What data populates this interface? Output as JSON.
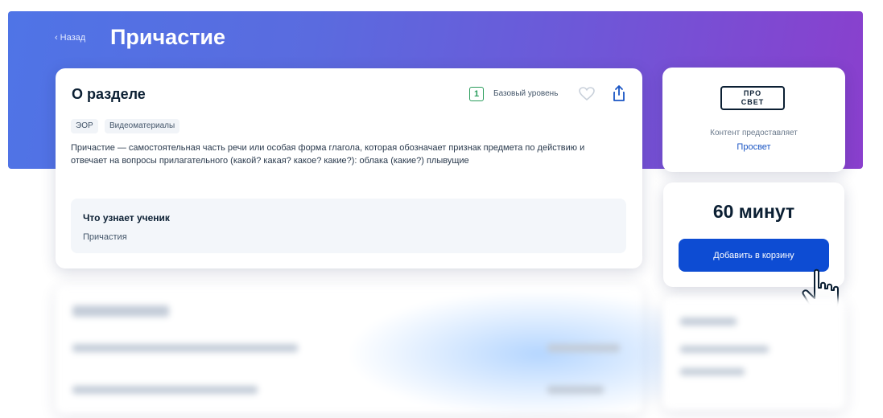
{
  "header": {
    "back_label": "Назад",
    "title": "Причастие"
  },
  "about": {
    "title": "О разделе",
    "level_number": "1",
    "level_label": "Базовый уровень",
    "tags": [
      "ЭОР",
      "Видеоматериалы"
    ],
    "description": "Причастие — самостоятельная часть речи или особая форма глагола, которая обозначает признак предмета по действию и отвечает на вопросы прилагательного (какой? какая? какое? какие?): облака (какие?) плывущие",
    "learn_title": "Что узнает ученик",
    "learn_item": "Причастия"
  },
  "provider": {
    "logo_line1": "ПРО",
    "logo_line2": "СВЕТ",
    "caption": "Контент предоставляет",
    "name": "Просвет"
  },
  "purchase": {
    "duration": "60 минут",
    "button_label": "Добавить в корзину"
  },
  "colors": {
    "hero_start": "#4f74e6",
    "hero_end": "#8a3fcd",
    "primary_button": "#0d4cd3",
    "level_badge": "#2a9d5c",
    "link": "#1a55c4"
  },
  "icons": {
    "back": "chevron-left-icon",
    "favorite": "heart-icon",
    "share": "share-icon",
    "cursor": "pointer-cursor-icon"
  }
}
